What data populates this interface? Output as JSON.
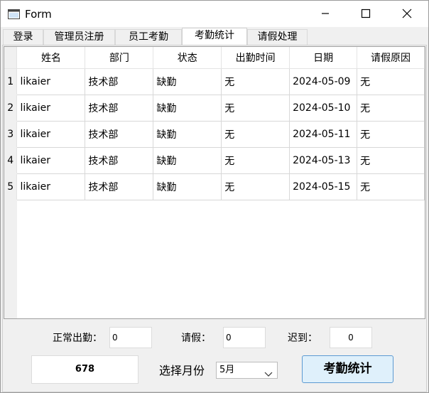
{
  "window": {
    "title": "Form"
  },
  "tabs": [
    {
      "label": "登录"
    },
    {
      "label": "管理员注册"
    },
    {
      "label": "员工考勤"
    },
    {
      "label": "考勤统计",
      "active": true
    },
    {
      "label": "请假处理"
    }
  ],
  "table": {
    "columns": [
      "姓名",
      "部门",
      "状态",
      "出勤时间",
      "日期",
      "请假原因"
    ],
    "rows": [
      {
        "num": "1",
        "cells": [
          "likaier",
          "技术部",
          "缺勤",
          "无",
          "2024-05-09",
          "无"
        ]
      },
      {
        "num": "2",
        "cells": [
          "likaier",
          "技术部",
          "缺勤",
          "无",
          "2024-05-10",
          "无"
        ]
      },
      {
        "num": "3",
        "cells": [
          "likaier",
          "技术部",
          "缺勤",
          "无",
          "2024-05-11",
          "无"
        ]
      },
      {
        "num": "4",
        "cells": [
          "likaier",
          "技术部",
          "缺勤",
          "无",
          "2024-05-13",
          "无"
        ]
      },
      {
        "num": "5",
        "cells": [
          "likaier",
          "技术部",
          "缺勤",
          "无",
          "2024-05-15",
          "无"
        ]
      }
    ]
  },
  "stats": {
    "normal_label": "正常出勤：",
    "normal_value": "0",
    "leave_label": "请假：",
    "leave_value": "0",
    "late_label": "迟到：",
    "late_value": "0"
  },
  "footer": {
    "id_value": "678",
    "month_label": "选择月份",
    "month_selected": "5月",
    "stat_button": "考勤统计"
  }
}
